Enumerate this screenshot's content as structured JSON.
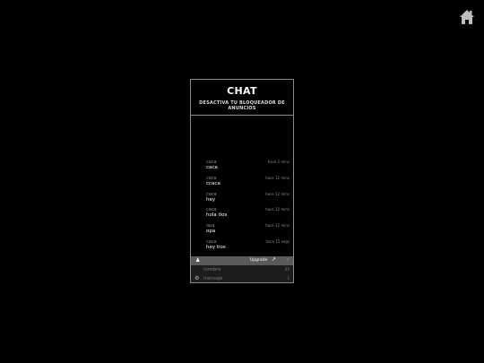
{
  "home": {
    "icon": "home-icon"
  },
  "chat": {
    "title": "CHAT",
    "subtitle": "DESACTIVA TU BLOQUEADOR DE ANUNCIOS",
    "messages": [
      {
        "user": "caca",
        "text": "caca",
        "time": "hace 2 mins"
      },
      {
        "user": "caca",
        "text": "ccaca",
        "time": "hace 12 mins"
      },
      {
        "user": "caca",
        "text": "hey",
        "time": "hace 12 mins"
      },
      {
        "user": "caca",
        "text": "hola tios",
        "time": "hace 12 mins"
      },
      {
        "user": "opa",
        "text": "opa",
        "time": "hace 12 mins"
      },
      {
        "user": "caca",
        "text": "hey tios",
        "time": "hace 15 segs"
      }
    ]
  },
  "toolbar": {
    "user_icon": "user-icon",
    "upgrade_label": "Upgrade",
    "external_icon": "external-link-icon",
    "close_glyph": "×"
  },
  "form": {
    "name_placeholder": "nombre",
    "name_count": "45",
    "message_placeholder": "mensaje",
    "message_count": "1",
    "settings_icon": "gear-icon"
  }
}
